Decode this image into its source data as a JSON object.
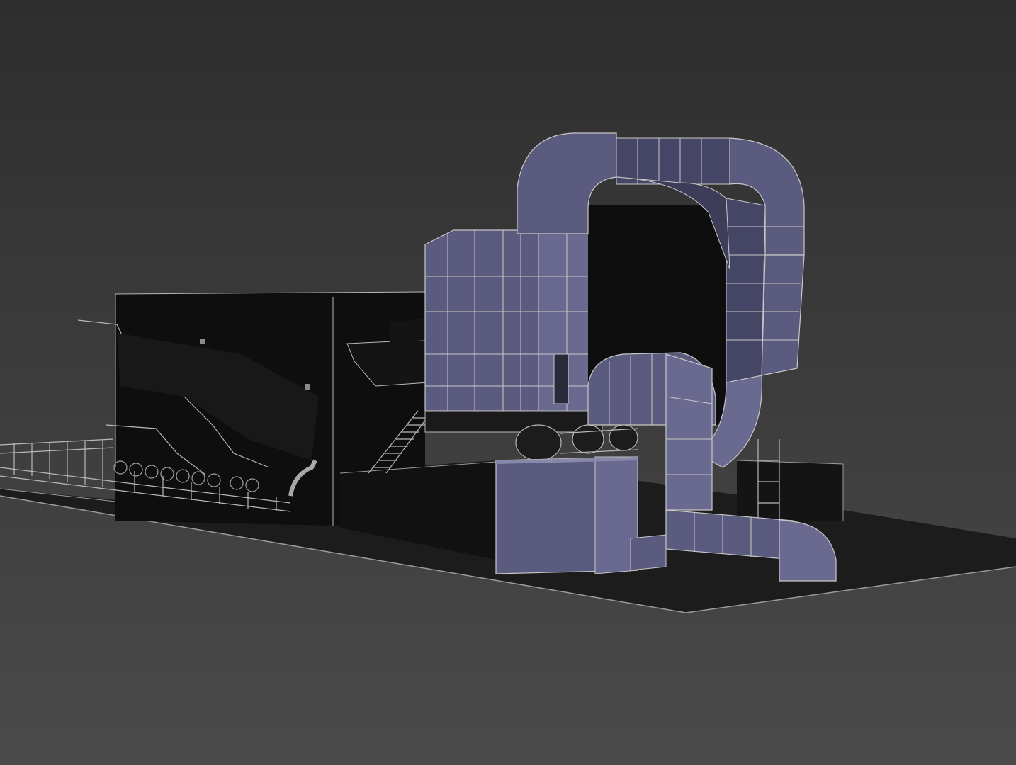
{
  "viewport": {
    "background_top": "#2e2e2e",
    "background_bottom": "#4a4a4a"
  },
  "colors": {
    "ground": "#1c1c1c",
    "ground_edge": "#9a9a9a",
    "wire": "#b8b8b8",
    "boiler_body": "#0e0e0e",
    "duct_face": "#5b5b7f",
    "duct_face_light": "#6a6a90",
    "duct_face_dark": "#454565",
    "duct_edge": "#c8c8c8",
    "shadow": "#101010"
  }
}
